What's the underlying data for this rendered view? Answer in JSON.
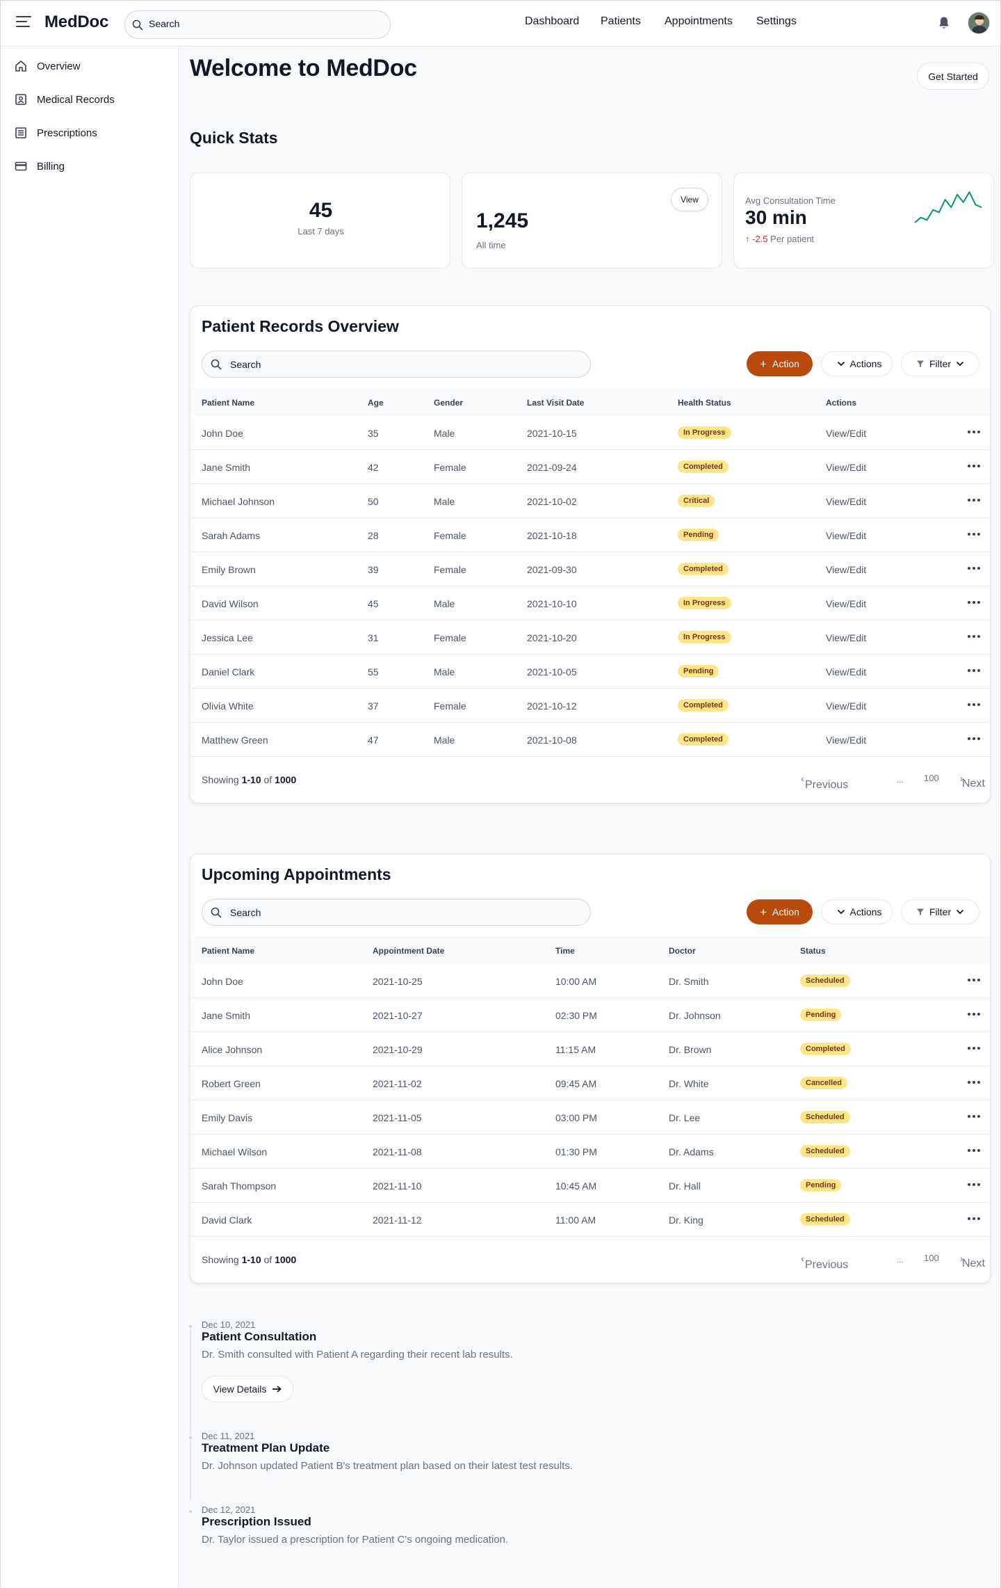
{
  "app": {
    "name": "MedDoc"
  },
  "header": {
    "search_placeholder": "Search",
    "nav": [
      "Dashboard",
      "Patients",
      "Appointments",
      "Settings"
    ]
  },
  "sidebar": {
    "items": [
      {
        "label": "Overview",
        "icon": "home-icon"
      },
      {
        "label": "Medical Records",
        "icon": "id-card-icon"
      },
      {
        "label": "Prescriptions",
        "icon": "list-icon"
      },
      {
        "label": "Billing",
        "icon": "credit-card-icon"
      }
    ]
  },
  "main": {
    "title": "Welcome to MedDoc",
    "get_started_label": "Get Started",
    "quick_stats_title": "Quick Stats"
  },
  "stats": {
    "card1": {
      "value": "45",
      "label": "Last 7 days"
    },
    "card2": {
      "value": "1,245",
      "label": "All time",
      "button": "View"
    },
    "card3": {
      "title": "Avg Consultation Time",
      "value": "30 min",
      "delta": "-2.5",
      "delta_label": "Per patient",
      "delta_color": "#dc2626",
      "sparkline_color": "#059669",
      "sparkline": [
        3,
        5,
        4,
        8,
        7,
        12,
        9,
        14,
        11,
        15,
        10,
        9
      ]
    }
  },
  "colors": {
    "accent": "#b84a0c",
    "badge_bg": "#fde68a",
    "badge_text": "#78350f"
  },
  "patients": {
    "title": "Patient Records Overview",
    "search_placeholder": "Search",
    "action_label": "Action",
    "actions_label": "Actions",
    "filter_label": "Filter",
    "columns": [
      "Patient Name",
      "Age",
      "Gender",
      "Last Visit Date",
      "Health Status",
      "Actions"
    ],
    "rows": [
      {
        "name": "John Doe",
        "age": "35",
        "gender": "Male",
        "date": "2021-10-15",
        "status": "In Progress",
        "action": "View/Edit"
      },
      {
        "name": "Jane Smith",
        "age": "42",
        "gender": "Female",
        "date": "2021-09-24",
        "status": "Completed",
        "action": "View/Edit"
      },
      {
        "name": "Michael Johnson",
        "age": "50",
        "gender": "Male",
        "date": "2021-10-02",
        "status": "Critical",
        "action": "View/Edit"
      },
      {
        "name": "Sarah Adams",
        "age": "28",
        "gender": "Female",
        "date": "2021-10-18",
        "status": "Pending",
        "action": "View/Edit"
      },
      {
        "name": "Emily Brown",
        "age": "39",
        "gender": "Female",
        "date": "2021-09-30",
        "status": "Completed",
        "action": "View/Edit"
      },
      {
        "name": "David Wilson",
        "age": "45",
        "gender": "Male",
        "date": "2021-10-10",
        "status": "In Progress",
        "action": "View/Edit"
      },
      {
        "name": "Jessica Lee",
        "age": "31",
        "gender": "Female",
        "date": "2021-10-20",
        "status": "In Progress",
        "action": "View/Edit"
      },
      {
        "name": "Daniel Clark",
        "age": "55",
        "gender": "Male",
        "date": "2021-10-05",
        "status": "Pending",
        "action": "View/Edit"
      },
      {
        "name": "Olivia White",
        "age": "37",
        "gender": "Female",
        "date": "2021-10-12",
        "status": "Completed",
        "action": "View/Edit"
      },
      {
        "name": "Matthew Green",
        "age": "47",
        "gender": "Male",
        "date": "2021-10-08",
        "status": "Completed",
        "action": "View/Edit"
      }
    ],
    "pagination": {
      "showing": "Showing",
      "range": "1-10",
      "of": "of",
      "total": "1000",
      "previous": "Previous",
      "ellipsis": "...",
      "last_page": "100",
      "next": "Next"
    }
  },
  "appointments": {
    "title": "Upcoming Appointments",
    "search_placeholder": "Search",
    "action_label": "Action",
    "actions_label": "Actions",
    "filter_label": "Filter",
    "columns": [
      "Patient Name",
      "Appointment Date",
      "Time",
      "Doctor",
      "Status"
    ],
    "rows": [
      {
        "name": "John Doe",
        "date": "2021-10-25",
        "time": "10:00 AM",
        "doctor": "Dr. Smith",
        "status": "Scheduled"
      },
      {
        "name": "Jane Smith",
        "date": "2021-10-27",
        "time": "02:30 PM",
        "doctor": "Dr. Johnson",
        "status": "Pending"
      },
      {
        "name": "Alice Johnson",
        "date": "2021-10-29",
        "time": "11:15 AM",
        "doctor": "Dr. Brown",
        "status": "Completed"
      },
      {
        "name": "Robert Green",
        "date": "2021-11-02",
        "time": "09:45 AM",
        "doctor": "Dr. White",
        "status": "Cancelled"
      },
      {
        "name": "Emily Davis",
        "date": "2021-11-05",
        "time": "03:00 PM",
        "doctor": "Dr. Lee",
        "status": "Scheduled"
      },
      {
        "name": "Michael Wilson",
        "date": "2021-11-08",
        "time": "01:30 PM",
        "doctor": "Dr. Adams",
        "status": "Scheduled"
      },
      {
        "name": "Sarah Thompson",
        "date": "2021-11-10",
        "time": "10:45 AM",
        "doctor": "Dr. Hall",
        "status": "Pending"
      },
      {
        "name": "David Clark",
        "date": "2021-11-12",
        "time": "11:00 AM",
        "doctor": "Dr. King",
        "status": "Scheduled"
      }
    ],
    "pagination": {
      "showing": "Showing",
      "range": "1-10",
      "of": "of",
      "total": "1000",
      "previous": "Previous",
      "ellipsis": "...",
      "last_page": "100",
      "next": "Next"
    }
  },
  "timeline": [
    {
      "date": "Dec 10, 2021",
      "title": "Patient Consultation",
      "description": "Dr. Smith consulted with Patient A regarding their recent lab results.",
      "button": "View Details"
    },
    {
      "date": "Dec 11, 2021",
      "title": "Treatment Plan Update",
      "description": "Dr. Johnson updated Patient B's treatment plan based on their latest test results."
    },
    {
      "date": "Dec 12, 2021",
      "title": "Prescription Issued",
      "description": "Dr. Taylor issued a prescription for Patient C's ongoing medication."
    }
  ]
}
